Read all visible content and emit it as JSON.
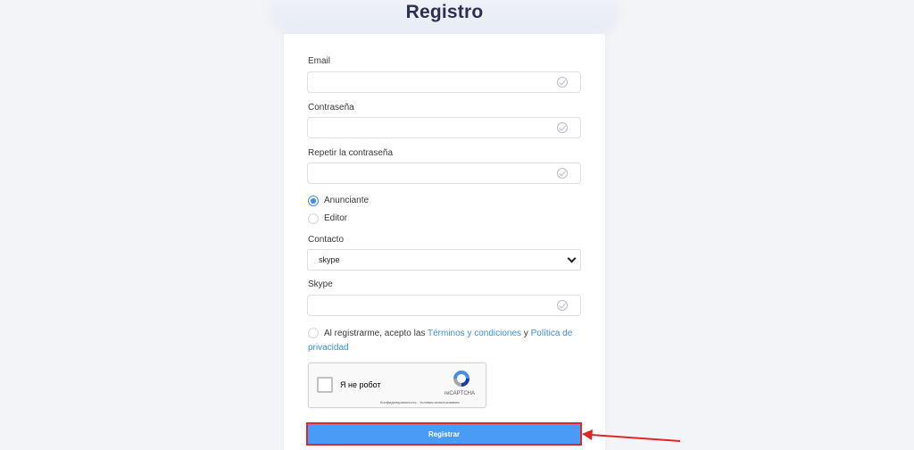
{
  "page": {
    "title": "Registro"
  },
  "form": {
    "email_label": "Email",
    "password_label": "Contraseña",
    "repeat_password_label": "Repetir la contraseña",
    "role_options": [
      {
        "label": "Anunciante",
        "selected": true
      },
      {
        "label": "Editor",
        "selected": false
      }
    ],
    "contact_label": "Contacto",
    "contact_value": "skype",
    "skype_label": "Skype",
    "terms": {
      "prefix": "Al registrarme, acepto las ",
      "terms_link": "Términos y condiciones",
      "conjunction": " y ",
      "privacy_link_1": "Política de",
      "privacy_link_2": "privacidad"
    },
    "captcha": {
      "checkbox_label": "Я не робот",
      "brand": "reCAPTCHA",
      "links": "Конфиденциальность - Условия использования"
    },
    "submit_label": "Registrar"
  },
  "colors": {
    "accent": "#4a9bf5",
    "link": "#3a8ee6",
    "highlight": "#e0262b"
  }
}
